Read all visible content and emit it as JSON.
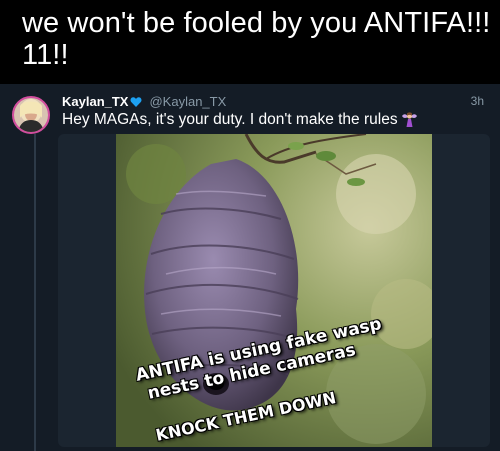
{
  "caption": {
    "line1": "we won't be fooled by you ANTIFA!!!",
    "line2": "11!!"
  },
  "tweet": {
    "display_name": "Kaylan_TX",
    "handle": "@Kaylan_TX",
    "timestamp": "3h",
    "text": "Hey MAGAs, it's your duty. I don't make the rules",
    "verified_icon": "verified-heart-icon",
    "emoji_icon": "fairy-icon"
  },
  "media": {
    "meme_line_1": "ANTIFA is using fake wasp",
    "meme_line_2": "nests to hide cameras",
    "meme_line_3": "KNOCK THEM DOWN"
  },
  "colors": {
    "background": "#000000",
    "tweet_background": "#141c26",
    "secondary_text": "#8899a6",
    "verified_blue": "#1da1f2"
  }
}
